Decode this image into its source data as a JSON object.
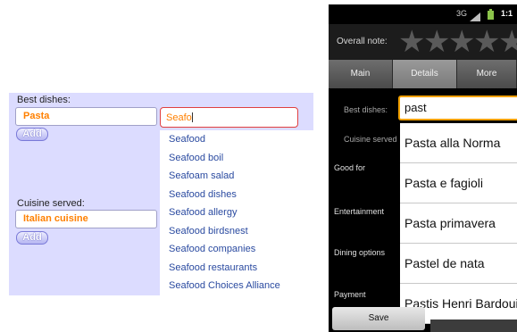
{
  "web_form": {
    "best_dishes_label": "Best dishes:",
    "best_dishes_value": "Pasta",
    "add_label": "Add",
    "search_value": "Seafo",
    "suggestions": [
      "Seafood",
      "Seafood boil",
      "Seafoam salad",
      "Seafood dishes",
      "Seafood allergy",
      "Seafood birdsnest",
      "Seafood companies",
      "Seafood restaurants",
      "Seafood Choices Alliance"
    ],
    "cuisine_label": "Cuisine served:",
    "cuisine_value": "Italian cuisine",
    "colors": {
      "panel_bg": "#dcdcff",
      "value_text": "#ff8000",
      "suggestion_text": "#2a4aa0",
      "focus_border": "#e04040"
    }
  },
  "android": {
    "status_bar": {
      "network": "3G",
      "icons": [
        "signal-icon",
        "battery-icon"
      ],
      "time": "1:1"
    },
    "overall_note_label": "Overall note:",
    "rating": {
      "value": 0,
      "max": 5
    },
    "tabs": [
      {
        "label": "Main",
        "active": false
      },
      {
        "label": "Details",
        "active": true
      },
      {
        "label": "More",
        "active": false
      }
    ],
    "rows": {
      "best_dishes": "Best dishes:",
      "cuisine_served": "Cuisine served",
      "good_for": "Good for",
      "entertainment": "Entertainment",
      "dining_options": "Dining options",
      "payment": "Payment"
    },
    "input_value": "past",
    "suggestions": [
      "Pasta alla Norma",
      "Pasta e fagioli",
      "Pasta primavera",
      "Pastel de nata",
      "Pastis Henri Bardouin"
    ],
    "save_label": "Save",
    "colors": {
      "input_focus_border": "#f0a000",
      "tab_active": "#8a8a8a",
      "tab_inactive": "#5a5a5a"
    }
  }
}
